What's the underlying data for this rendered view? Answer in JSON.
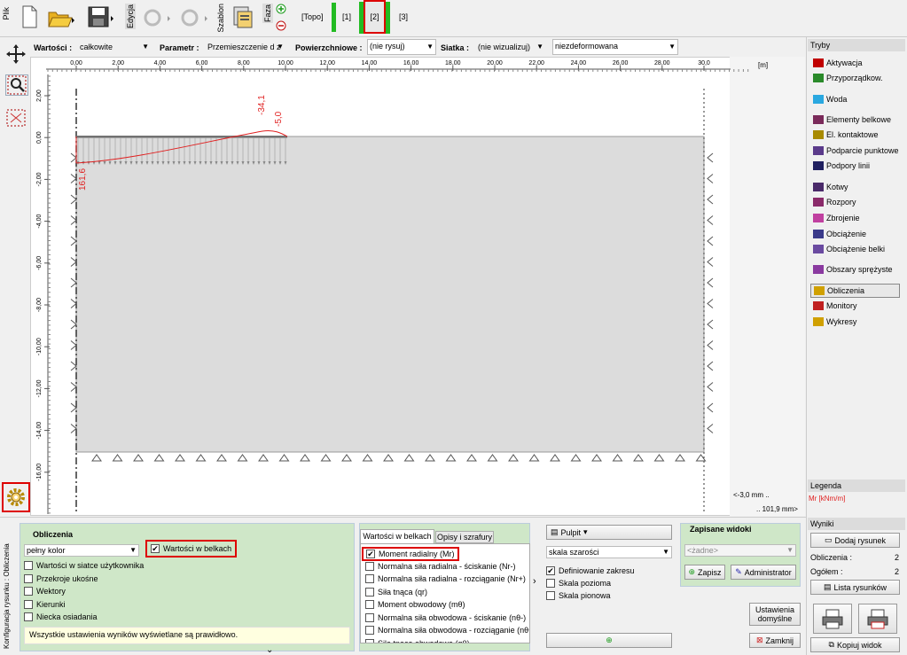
{
  "toolbar": {
    "plik": "Plik",
    "edycja": "Edycja",
    "szablon": "Szablon",
    "faza": "Faza",
    "stages": [
      "[Topo]",
      "[1]",
      "[2]",
      "[3]"
    ]
  },
  "filters": {
    "wartosci": {
      "label": "Wartości :",
      "value": "całkowite"
    },
    "parametr": {
      "label": "Parametr :",
      "value": "Przemieszczenie d z"
    },
    "powierzchniowe": {
      "label": "Powierzchniowe :",
      "value": "(nie rysuj)"
    },
    "siatka": {
      "label": "Siatka :",
      "value": "(nie wizualizuj)"
    },
    "deform": {
      "value": "niezdeformowana"
    }
  },
  "ruler": {
    "x_ticks": [
      "0,00",
      "2,00",
      "4,00",
      "6,00",
      "8,00",
      "10,00",
      "12,00",
      "14,00",
      "16,00",
      "18,00",
      "20,00",
      "22,00",
      "24,00",
      "26,00",
      "28,00",
      "30,0"
    ],
    "unit": "[m]",
    "y_ticks": [
      "2,00",
      "0,00",
      "-2,00",
      "-4,00",
      "-6,00",
      "-8,00",
      "-10,00",
      "-12,00",
      "-14,00",
      "-16,00"
    ]
  },
  "annotations": {
    "v1": "-34,1",
    "v2": "-5,0",
    "v3": "161,6"
  },
  "scale": {
    "line1": "<-3,0 mm ..",
    "line2": ".. 101,9 mm>"
  },
  "tryby": {
    "title": "Tryby",
    "items": [
      {
        "label": "Aktywacja",
        "icon": "activation-icon",
        "color": "#c00000"
      },
      {
        "label": "Przyporządkow.",
        "icon": "assign-icon",
        "color": "#2a8a2a"
      },
      {
        "label": "Woda",
        "icon": "water-icon",
        "color": "#2aa8e0"
      },
      {
        "label": "Elementy belkowe",
        "icon": "beam-icon",
        "color": "#7a2a5a"
      },
      {
        "label": "El. kontaktowe",
        "icon": "contact-icon",
        "color": "#a88a00"
      },
      {
        "label": "Podparcie punktowe",
        "icon": "point-support-icon",
        "color": "#5a3a8a"
      },
      {
        "label": "Podpory linii",
        "icon": "line-support-icon",
        "color": "#202060"
      },
      {
        "label": "Kotwy",
        "icon": "anchor-icon",
        "color": "#4a2a6a"
      },
      {
        "label": "Rozpory",
        "icon": "strut-icon",
        "color": "#8a2a6a"
      },
      {
        "label": "Zbrojenie",
        "icon": "reinforcement-icon",
        "color": "#c040a0"
      },
      {
        "label": "Obciążenie",
        "icon": "load-icon",
        "color": "#3a3a8a"
      },
      {
        "label": "Obciążenie belki",
        "icon": "beam-load-icon",
        "color": "#6a4aa0"
      },
      {
        "label": "Obszary sprężyste",
        "icon": "elastic-icon",
        "color": "#8a3aa0"
      },
      {
        "label": "Obliczenia",
        "icon": "calculation-icon",
        "color": "#d0a000"
      },
      {
        "label": "Monitory",
        "icon": "monitor-icon",
        "color": "#c02020"
      },
      {
        "label": "Wykresy",
        "icon": "chart-icon",
        "color": "#d0a000"
      }
    ]
  },
  "legenda": {
    "title": "Legenda",
    "unit": "Mr [kNm/m]"
  },
  "wyniki": {
    "title": "Wyniki",
    "add": "Dodaj rysunek",
    "obliczenia_label": "Obliczenia :",
    "obliczenia_val": "2",
    "ogolem_label": "Ogółem :",
    "ogolem_val": "2",
    "lista": "Lista rysunków",
    "kopiuj": "Kopiuj widok"
  },
  "bottom": {
    "side_label": "Konfiguracja rysunku : Obliczenia",
    "group_title": "Obliczenia",
    "color_mode": "pełny kolor",
    "beam_values": "Wartości w belkach",
    "checks": [
      "Wartości w siatce użytkownika",
      "Przekroje ukośne",
      "Wektory",
      "Kierunki",
      "Niecka osiadania"
    ],
    "status": "Wszystkie ustawienia wyników wyświetlane są prawidłowo.",
    "tabs": [
      "Wartości w belkach",
      "Opisy i szrafury"
    ],
    "beam_checks": [
      "Moment radialny (Mr)",
      "Normalna siła radialna - ściskanie (Nr-)",
      "Normalna siła radialna - rozciąganie (Nr+)",
      "Siła tnąca (qr)",
      "Moment obwodowy (mθ)",
      "Normalna siła obwodowa - ściskanie (nθ-)",
      "Normalna siła obwodowa - rozciąganie (nθ+)",
      "Siła tnąca obwodowa (qθ)"
    ],
    "pulpit": "Pulpit",
    "skala": "skala szarości",
    "def_zakresu": "Definiowanie zakresu",
    "skala_pozioma": "Skala pozioma",
    "skala_pionowa": "Skala pionowa",
    "zapisane": "Zapisane widoki",
    "zadne": "<żadne>",
    "zapisz": "Zapisz",
    "administrator": "Administrator",
    "ustawienia": "Ustawienia domyślne",
    "zamknij": "Zamknij"
  }
}
